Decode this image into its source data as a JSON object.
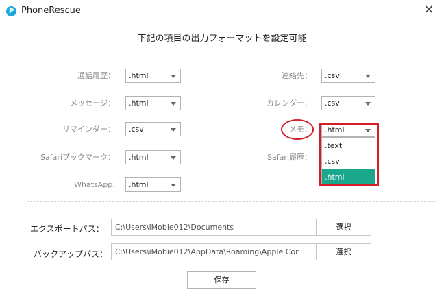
{
  "window": {
    "logo_letter": "P",
    "title": "PhoneRescue",
    "close_symbol": "✕"
  },
  "heading": "下記の項目の出力フォーマットを設定可能",
  "fields": {
    "call_history": {
      "label": "通話履歴：",
      "value": ".html"
    },
    "contacts": {
      "label": "連絡先：",
      "value": ".csv"
    },
    "messages": {
      "label": "メッセージ：",
      "value": ".html"
    },
    "calendar": {
      "label": "カレンダー：",
      "value": ".csv"
    },
    "reminders": {
      "label": "リマインダー：",
      "value": ".csv"
    },
    "notes": {
      "label": "メモ：",
      "value": ".html"
    },
    "safari_bookmarks": {
      "label": "Safariブックマーク：",
      "value": ".html"
    },
    "safari_history": {
      "label": "Safari履歴："
    },
    "whatsapp": {
      "label": "WhatsApp:",
      "value": ".html"
    }
  },
  "notes_dropdown": {
    "options": [
      ".text",
      ".csv",
      ".html"
    ],
    "selected": ".html"
  },
  "export_path": {
    "label": "エクスポートパス：",
    "value": "C:\\Users\\iMobie012\\Documents",
    "browse_label": "選択"
  },
  "backup_path": {
    "label": "バックアップパス：",
    "value": "C:\\Users\\iMobie012\\AppData\\Roaming\\Apple Cor",
    "browse_label": "選択"
  },
  "save_label": "保存",
  "colors": {
    "accent": "#1aa78b",
    "highlight": "#d41f27",
    "logo": "#19a9d9"
  },
  "icons": {
    "app_logo": "phonerescue-logo-icon",
    "close": "close-icon",
    "dropdown_arrow": "chevron-down-icon"
  }
}
